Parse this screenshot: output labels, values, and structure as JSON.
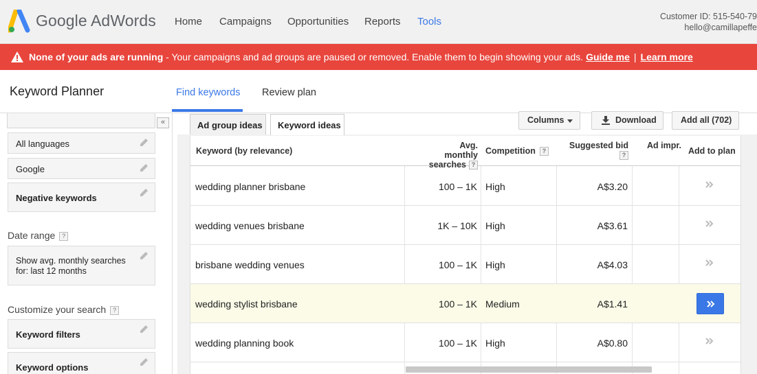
{
  "header": {
    "brand": "Google AdWords",
    "nav": [
      "Home",
      "Campaigns",
      "Opportunities",
      "Reports",
      "Tools"
    ],
    "active_nav": "Tools",
    "customer_id": "Customer ID: 515-540-79",
    "email": "hello@camillapeffe"
  },
  "alert": {
    "icon": "warning-icon",
    "bold_text": "None of your ads are running",
    "text": " - Your campaigns and ad groups are paused or removed. Enable them to begin showing your ads. ",
    "guide_link": "Guide me",
    "separator": "|",
    "learn_link": "Learn more"
  },
  "planner": {
    "title": "Keyword Planner",
    "tabs": [
      "Find keywords",
      "Review plan"
    ],
    "active_tab": "Find keywords"
  },
  "sidebar": {
    "collapse_glyph": "«",
    "targeting": [
      "All languages",
      "Google",
      "Negative keywords"
    ],
    "date_range_label": "Date range",
    "date_range_value": "Show avg. monthly searches for: last 12 months",
    "customize_label": "Customize your search",
    "customize_items": [
      "Keyword filters",
      "Keyword options"
    ],
    "help_glyph": "?"
  },
  "tool": {
    "subtabs": [
      "Ad group ideas",
      "Keyword ideas"
    ],
    "active_subtab": "Keyword ideas",
    "columns_label": "Columns",
    "download_label": "Download",
    "add_all_label": "Add all (702)"
  },
  "table": {
    "headers": {
      "keyword": "Keyword (by relevance)",
      "searches_1": "Avg. monthly",
      "searches_2": "searches",
      "competition": "Competition",
      "bid": "Suggested bid",
      "impr": "Ad impr.",
      "add": "Add to plan",
      "help": "?"
    },
    "rows": [
      {
        "keyword": "wedding planner brisbane",
        "searches": "100 – 1K",
        "competition": "High",
        "bid": "A$3.20"
      },
      {
        "keyword": "wedding venues brisbane",
        "searches": "1K – 10K",
        "competition": "High",
        "bid": "A$3.61"
      },
      {
        "keyword": "brisbane wedding venues",
        "searches": "100 – 1K",
        "competition": "High",
        "bid": "A$4.03"
      },
      {
        "keyword": "wedding stylist brisbane",
        "searches": "100 – 1K",
        "competition": "Medium",
        "bid": "A$1.41"
      },
      {
        "keyword": "wedding planning book",
        "searches": "100 – 1K",
        "competition": "High",
        "bid": "A$0.80"
      }
    ],
    "highlighted_row": 3
  },
  "colors": {
    "alert_red": "#e8453c",
    "accent_blue": "#3b78e7",
    "highlight_row": "#fbfbe8"
  }
}
